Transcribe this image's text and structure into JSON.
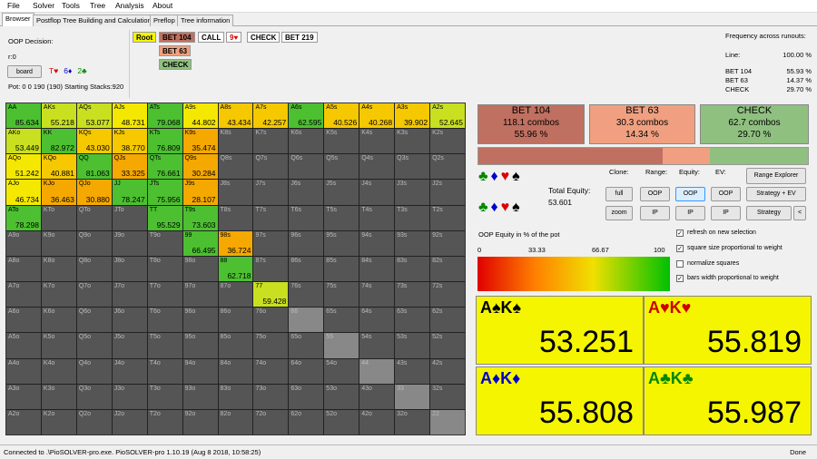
{
  "menu": [
    "File",
    "Solver",
    "Tools",
    "Tree",
    "Analysis",
    "About"
  ],
  "tabs": [
    "Browser",
    "Postflop Tree Building and Calculations",
    "Preflop",
    "Tree information"
  ],
  "decision": {
    "label": "OOP Decision:",
    "line": "r:0",
    "board_btn": "board",
    "board_cards": [
      {
        "t": "T♥",
        "c": "#d00"
      },
      {
        "t": "6♦",
        "c": "#00c"
      },
      {
        "t": "2♣",
        "c": "#080"
      }
    ],
    "pot": "Pot: 0 0 190 (190) Starting Stacks:920"
  },
  "actions": {
    "row1": [
      "Root",
      "BET 104",
      "CALL",
      "9♥",
      "CHECK",
      "BET 219"
    ],
    "row2": "BET 63",
    "row3": "CHECK"
  },
  "freq": {
    "title": "Frequency across runouts:",
    "line_label": "Line:",
    "line_value": "100.00 %",
    "rows": [
      {
        "k": "BET 104",
        "v": "55.93 %"
      },
      {
        "k": "BET 63",
        "v": "14.37 %"
      },
      {
        "k": "CHECK",
        "v": "29.70 %"
      }
    ]
  },
  "grid": [
    [
      [
        "AA",
        "85.634"
      ],
      [
        "AKs",
        "55.218"
      ],
      [
        "AQs",
        "53.077"
      ],
      [
        "AJs",
        "48.731"
      ],
      [
        "ATs",
        "79.068"
      ],
      [
        "A9s",
        "44.802"
      ],
      [
        "A8s",
        "43.434"
      ],
      [
        "A7s",
        "42.257"
      ],
      [
        "A6s",
        "62.595"
      ],
      [
        "A5s",
        "40.526"
      ],
      [
        "A4s",
        "40.268"
      ],
      [
        "A3s",
        "39.902"
      ],
      [
        "A2s",
        "52.645"
      ]
    ],
    [
      [
        "AKo",
        "53.449"
      ],
      [
        "KK",
        "82.972"
      ],
      [
        "KQs",
        "43.030"
      ],
      [
        "KJs",
        "38.770"
      ],
      [
        "KTs",
        "76.809"
      ],
      [
        "K9s",
        "35.474"
      ],
      [
        "K8s",
        ""
      ],
      [
        "K7s",
        ""
      ],
      [
        "K6s",
        ""
      ],
      [
        "K5s",
        ""
      ],
      [
        "K4s",
        ""
      ],
      [
        "K3s",
        ""
      ],
      [
        "K2s",
        ""
      ]
    ],
    [
      [
        "AQo",
        "51.242"
      ],
      [
        "KQo",
        "40.881"
      ],
      [
        "QQ",
        "81.063"
      ],
      [
        "QJs",
        "33.325"
      ],
      [
        "QTs",
        "76.661"
      ],
      [
        "Q9s",
        "30.284"
      ],
      [
        "Q8s",
        ""
      ],
      [
        "Q7s",
        ""
      ],
      [
        "Q6s",
        ""
      ],
      [
        "Q5s",
        ""
      ],
      [
        "Q4s",
        ""
      ],
      [
        "Q3s",
        ""
      ],
      [
        "Q2s",
        ""
      ]
    ],
    [
      [
        "AJo",
        "46.734"
      ],
      [
        "KJo",
        "36.463"
      ],
      [
        "QJo",
        "30.880"
      ],
      [
        "JJ",
        "78.247"
      ],
      [
        "JTs",
        "75.956"
      ],
      [
        "J9s",
        "28.107"
      ],
      [
        "J8s",
        ""
      ],
      [
        "J7s",
        ""
      ],
      [
        "J6s",
        ""
      ],
      [
        "J5s",
        ""
      ],
      [
        "J4s",
        ""
      ],
      [
        "J3s",
        ""
      ],
      [
        "J2s",
        ""
      ]
    ],
    [
      [
        "ATo",
        "78.298"
      ],
      [
        "KTo",
        ""
      ],
      [
        "QTo",
        ""
      ],
      [
        "JTo",
        ""
      ],
      [
        "TT",
        "95.529"
      ],
      [
        "T9s",
        "73.603"
      ],
      [
        "T8s",
        ""
      ],
      [
        "T7s",
        ""
      ],
      [
        "T6s",
        ""
      ],
      [
        "T5s",
        ""
      ],
      [
        "T4s",
        ""
      ],
      [
        "T3s",
        ""
      ],
      [
        "T2s",
        ""
      ]
    ],
    [
      [
        "A9o",
        ""
      ],
      [
        "K9o",
        ""
      ],
      [
        "Q9o",
        ""
      ],
      [
        "J9o",
        ""
      ],
      [
        "T9o",
        ""
      ],
      [
        "99",
        "66.495"
      ],
      [
        "98s",
        "36.724"
      ],
      [
        "97s",
        ""
      ],
      [
        "96s",
        ""
      ],
      [
        "95s",
        ""
      ],
      [
        "94s",
        ""
      ],
      [
        "93s",
        ""
      ],
      [
        "92s",
        ""
      ]
    ],
    [
      [
        "A8o",
        ""
      ],
      [
        "K8o",
        ""
      ],
      [
        "Q8o",
        ""
      ],
      [
        "J8o",
        ""
      ],
      [
        "T8o",
        ""
      ],
      [
        "98o",
        ""
      ],
      [
        "88",
        "62.718"
      ],
      [
        "87s",
        ""
      ],
      [
        "86s",
        ""
      ],
      [
        "85s",
        ""
      ],
      [
        "84s",
        ""
      ],
      [
        "83s",
        ""
      ],
      [
        "82s",
        ""
      ]
    ],
    [
      [
        "A7o",
        ""
      ],
      [
        "K7o",
        ""
      ],
      [
        "Q7o",
        ""
      ],
      [
        "J7o",
        ""
      ],
      [
        "T7o",
        ""
      ],
      [
        "97o",
        ""
      ],
      [
        "87o",
        ""
      ],
      [
        "77",
        "59.428"
      ],
      [
        "76s",
        ""
      ],
      [
        "75s",
        ""
      ],
      [
        "74s",
        ""
      ],
      [
        "73s",
        ""
      ],
      [
        "72s",
        ""
      ]
    ],
    [
      [
        "A6o",
        ""
      ],
      [
        "K6o",
        ""
      ],
      [
        "Q6o",
        ""
      ],
      [
        "J6o",
        ""
      ],
      [
        "T6o",
        ""
      ],
      [
        "96o",
        ""
      ],
      [
        "86o",
        ""
      ],
      [
        "76o",
        ""
      ],
      [
        "66",
        ""
      ],
      [
        "65s",
        ""
      ],
      [
        "64s",
        ""
      ],
      [
        "63s",
        ""
      ],
      [
        "62s",
        ""
      ]
    ],
    [
      [
        "A5o",
        ""
      ],
      [
        "K5o",
        ""
      ],
      [
        "Q5o",
        ""
      ],
      [
        "J5o",
        ""
      ],
      [
        "T5o",
        ""
      ],
      [
        "95o",
        ""
      ],
      [
        "85o",
        ""
      ],
      [
        "75o",
        ""
      ],
      [
        "65o",
        ""
      ],
      [
        "55",
        ""
      ],
      [
        "54s",
        ""
      ],
      [
        "53s",
        ""
      ],
      [
        "52s",
        ""
      ]
    ],
    [
      [
        "A4o",
        ""
      ],
      [
        "K4o",
        ""
      ],
      [
        "Q4o",
        ""
      ],
      [
        "J4o",
        ""
      ],
      [
        "T4o",
        ""
      ],
      [
        "94o",
        ""
      ],
      [
        "84o",
        ""
      ],
      [
        "74o",
        ""
      ],
      [
        "64o",
        ""
      ],
      [
        "54o",
        ""
      ],
      [
        "44",
        ""
      ],
      [
        "43s",
        ""
      ],
      [
        "42s",
        ""
      ]
    ],
    [
      [
        "A3o",
        ""
      ],
      [
        "K3o",
        ""
      ],
      [
        "Q3o",
        ""
      ],
      [
        "J3o",
        ""
      ],
      [
        "T3o",
        ""
      ],
      [
        "93o",
        ""
      ],
      [
        "83o",
        ""
      ],
      [
        "73o",
        ""
      ],
      [
        "63o",
        ""
      ],
      [
        "53o",
        ""
      ],
      [
        "43o",
        ""
      ],
      [
        "33",
        ""
      ],
      [
        "32s",
        ""
      ]
    ],
    [
      [
        "A2o",
        ""
      ],
      [
        "K2o",
        ""
      ],
      [
        "Q2o",
        ""
      ],
      [
        "J2o",
        ""
      ],
      [
        "T2o",
        ""
      ],
      [
        "92o",
        ""
      ],
      [
        "82o",
        ""
      ],
      [
        "72o",
        ""
      ],
      [
        "62o",
        ""
      ],
      [
        "52o",
        ""
      ],
      [
        "42o",
        ""
      ],
      [
        "32o",
        ""
      ],
      [
        "22",
        ""
      ]
    ]
  ],
  "stats": [
    {
      "title": "BET 104",
      "combos": "118.1 combos",
      "pct": "55.96 %",
      "color": "#c07060"
    },
    {
      "title": "BET 63",
      "combos": "30.3 combos",
      "pct": "14.34 %",
      "color": "#f0a080"
    },
    {
      "title": "CHECK",
      "combos": "62.7 combos",
      "pct": "29.70 %",
      "color": "#8fc080"
    }
  ],
  "controls": {
    "clone": "Clone:",
    "range": "Range:",
    "equity": "Equity:",
    "ev": "EV:",
    "full": "full",
    "zoom": "zoom",
    "oop": "OOP",
    "ip": "IP",
    "range_explorer": "Range Explorer",
    "strategy_ev": "Strategy + EV",
    "strategy": "Strategy",
    "arrow": "<",
    "total_equity_label": "Total Equity:",
    "total_equity": "53.601"
  },
  "equity_bar": {
    "label": "OOP Equity in % of the pot",
    "ticks": [
      "0",
      "33.33",
      "66.67",
      "100"
    ]
  },
  "options": [
    {
      "label": "refresh on new selection",
      "checked": true
    },
    {
      "label": "square size proportional to weight",
      "checked": true
    },
    {
      "label": "normalize squares",
      "checked": false
    },
    {
      "label": "bars width proportional to weight",
      "checked": true
    }
  ],
  "suits": [
    {
      "hand": "A♠K♠",
      "color": "#000",
      "value": "53.251"
    },
    {
      "hand": "A♥K♥",
      "color": "#c00",
      "value": "55.819"
    },
    {
      "hand": "A♦K♦",
      "color": "#00c",
      "value": "55.808"
    },
    {
      "hand": "A♣K♣",
      "color": "#080",
      "value": "55.987"
    }
  ],
  "status": {
    "left": "Connected to .\\PioSOLVER-pro.exe. PioSOLVER-pro 1.10.19 (Aug  8 2018, 10:58:25)",
    "right": "Done"
  }
}
